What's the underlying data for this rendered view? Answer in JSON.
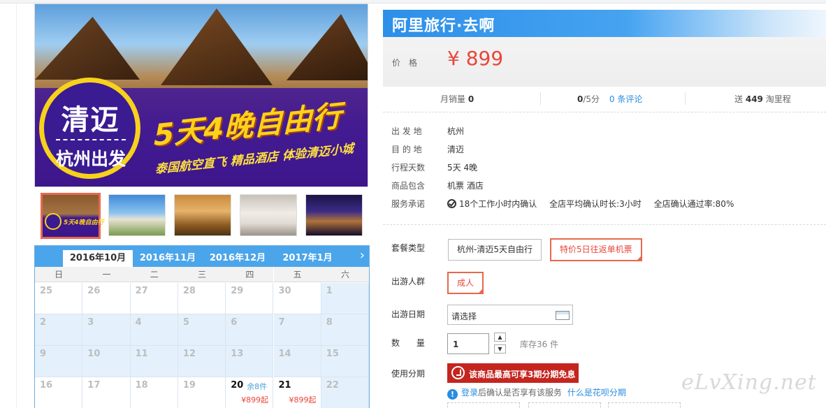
{
  "banner": {
    "badge_city": "清迈",
    "badge_origin": "杭州出发",
    "headline": "5天4晚自由行",
    "subline": "泰国航空直飞 精品酒店 体验清迈小城"
  },
  "thumbnails": [
    {
      "name": "thumb-1",
      "active": true,
      "mini_text": "5天4晚自由行"
    },
    {
      "name": "thumb-2",
      "active": false
    },
    {
      "name": "thumb-3",
      "active": false
    },
    {
      "name": "thumb-4",
      "active": false
    },
    {
      "name": "thumb-5",
      "active": false
    }
  ],
  "calendar": {
    "months": [
      "2016年10月",
      "2016年11月",
      "2016年12月",
      "2017年1月"
    ],
    "active_month": 0,
    "next_glyph": "›",
    "weekdays": [
      "日",
      "一",
      "二",
      "三",
      "四",
      "五",
      "六"
    ],
    "weeks": [
      [
        {
          "d": "25"
        },
        {
          "d": "26"
        },
        {
          "d": "27"
        },
        {
          "d": "28"
        },
        {
          "d": "29"
        },
        {
          "d": "30"
        },
        {
          "d": "1"
        }
      ],
      [
        {
          "d": "2"
        },
        {
          "d": "3"
        },
        {
          "d": "4"
        },
        {
          "d": "5"
        },
        {
          "d": "6"
        },
        {
          "d": "7"
        },
        {
          "d": "8"
        }
      ],
      [
        {
          "d": "9"
        },
        {
          "d": "10"
        },
        {
          "d": "11"
        },
        {
          "d": "12"
        },
        {
          "d": "13"
        },
        {
          "d": "14"
        },
        {
          "d": "15"
        }
      ],
      [
        {
          "d": "16"
        },
        {
          "d": "17"
        },
        {
          "d": "18"
        },
        {
          "d": "19"
        },
        {
          "d": "20",
          "stock": "余8件",
          "price": "¥899起"
        },
        {
          "d": "21",
          "price": "¥899起"
        },
        {
          "d": "22"
        }
      ]
    ]
  },
  "product": {
    "brand": "阿里旅行·去啊",
    "price_label": "价格",
    "price": "¥ 899",
    "stats": {
      "monthly_sales_label": "月销量",
      "monthly_sales": "0",
      "rating": "0",
      "rating_suffix": "/5分",
      "reviews": "0 条评论",
      "points_prefix": "送",
      "points": "449",
      "points_suffix": "淘里程"
    },
    "info": [
      {
        "label": "出 发 地",
        "value": "杭州"
      },
      {
        "label": "目 的 地",
        "value": "清迈"
      },
      {
        "label": "行程天数",
        "value": "5天 4晚"
      },
      {
        "label": "商品包含",
        "value": "机票   酒店"
      }
    ],
    "service": {
      "label": "服务承诺",
      "items": [
        "18个工作小时内确认",
        "全店平均确认时长:3小时",
        "全店确认通过率:80%"
      ]
    }
  },
  "form": {
    "package_label": "套餐类型",
    "packages": [
      {
        "label": "杭州-清迈5天自由行",
        "selected": false
      },
      {
        "label": "特价5日往返单机票",
        "selected": true
      }
    ],
    "traveler_label": "出游人群",
    "traveler_option": "成人",
    "date_label": "出游日期",
    "date_placeholder": "请选择",
    "qty_label": "数 量",
    "qty_value": "1",
    "step_up": "▲",
    "step_down": "▼",
    "stock_text": "库存36 件",
    "installment_label": "使用分期",
    "installment_banner": "该商品最高可享3期分期免息",
    "installment_note_link1": "登录",
    "installment_note_text": "后确认是否享有该服务",
    "installment_note_link2": "什么是花呗分期",
    "info_glyph": "!"
  },
  "watermark": "eLvXing.net"
}
